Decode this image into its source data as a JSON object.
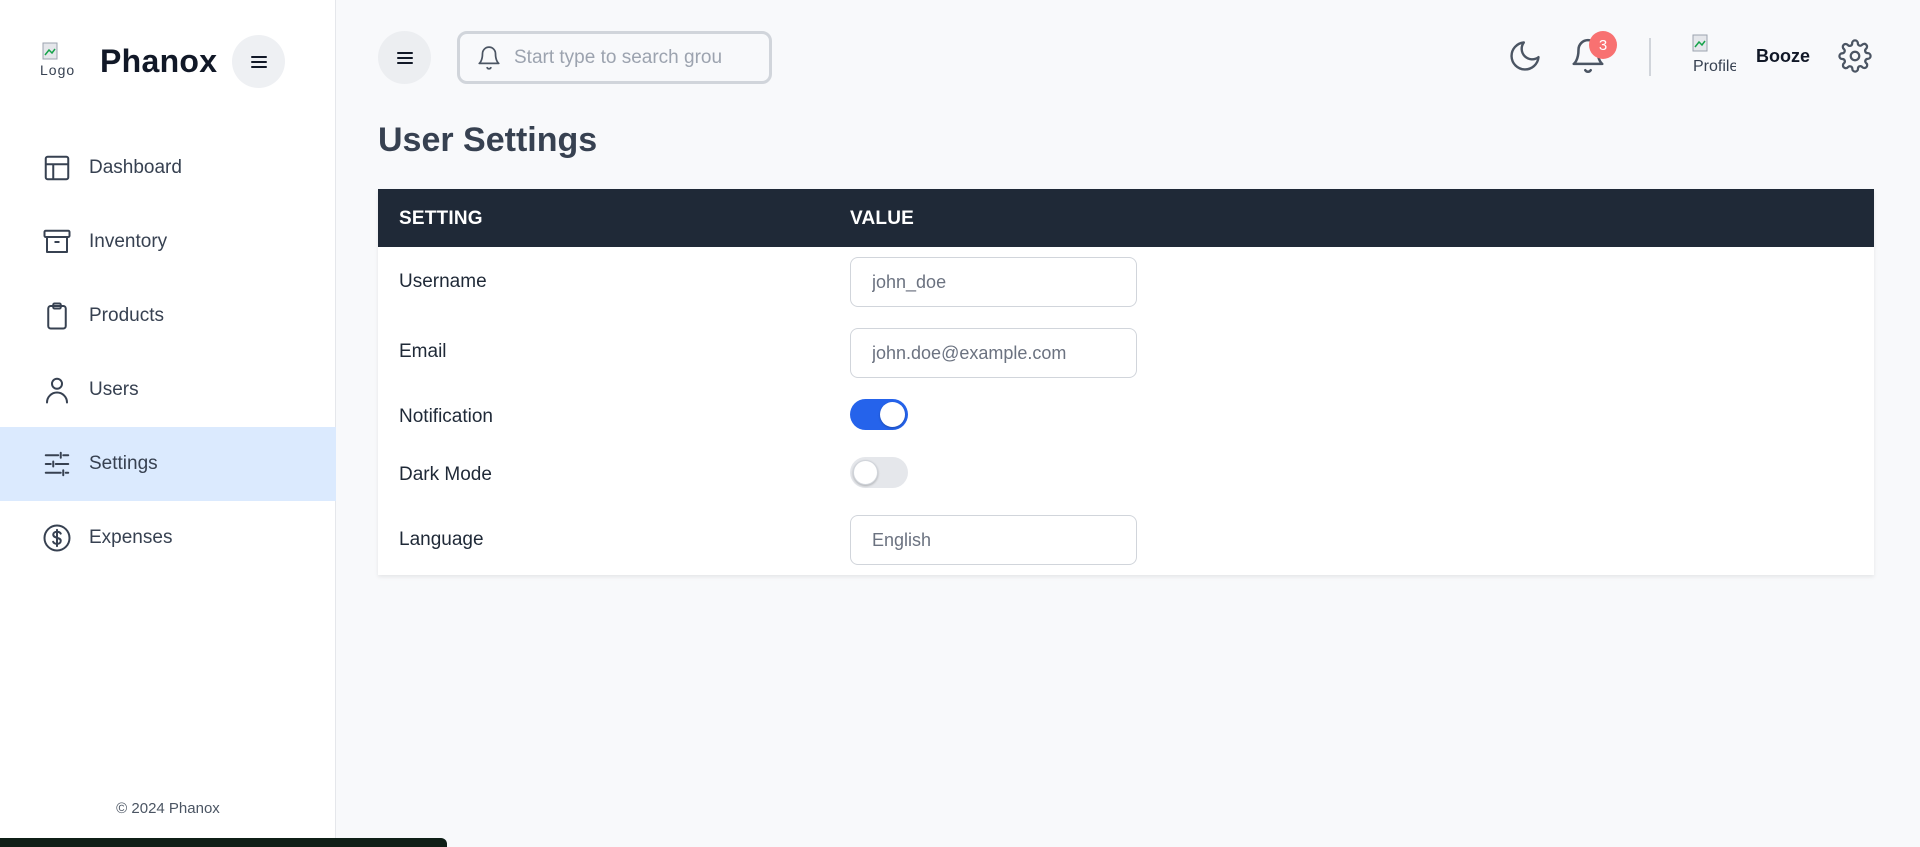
{
  "brand": {
    "name": "Phanox",
    "logo_alt": "Logo"
  },
  "sidebar": {
    "items": [
      {
        "label": "Dashboard",
        "icon": "layout-icon"
      },
      {
        "label": "Inventory",
        "icon": "archive-icon"
      },
      {
        "label": "Products",
        "icon": "clipboard-icon"
      },
      {
        "label": "Users",
        "icon": "user-icon"
      },
      {
        "label": "Settings",
        "icon": "sliders-icon",
        "active": true
      },
      {
        "label": "Expenses",
        "icon": "dollar-circle-icon"
      }
    ],
    "copyright": "© 2024 Phanox"
  },
  "header": {
    "search_placeholder": "Start type to search grou",
    "notification_count": "3",
    "avatar_alt": "Profile",
    "user_name": "Booze"
  },
  "main": {
    "title": "User Settings",
    "table": {
      "headers": [
        "SETTING",
        "VALUE"
      ],
      "rows": [
        {
          "label": "Username",
          "type": "text",
          "placeholder": "john_doe"
        },
        {
          "label": "Email",
          "type": "text",
          "placeholder": "john.doe@example.com"
        },
        {
          "label": "Notification",
          "type": "toggle",
          "value": true
        },
        {
          "label": "Dark Mode",
          "type": "toggle",
          "value": false
        },
        {
          "label": "Language",
          "type": "text",
          "placeholder": "English"
        }
      ]
    }
  },
  "colors": {
    "accent": "#2563eb",
    "active_nav_bg": "#dbeafe",
    "table_header_bg": "#1f2937",
    "badge": "#f87171"
  }
}
